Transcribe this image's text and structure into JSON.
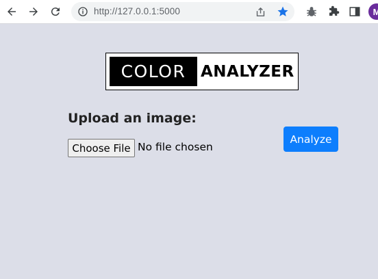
{
  "browser": {
    "url": "http://127.0.0.1:5000",
    "profile_initial": "M",
    "icons": {
      "back": "back-arrow-icon",
      "forward": "forward-arrow-icon",
      "reload": "reload-icon",
      "info": "info-icon",
      "share": "share-icon",
      "bookmark": "star-icon",
      "extension_bug": "bug-icon",
      "extensions": "puzzle-icon",
      "side_panel": "side-panel-icon"
    },
    "colors": {
      "star": "#1a73e8",
      "avatar": "#6a2d9c"
    }
  },
  "page": {
    "logo": {
      "part1": "COLOR",
      "part2": "ANALYZER"
    },
    "upload_label": "Upload an image:",
    "file_button": "Choose File",
    "file_status": "No file chosen",
    "analyze_button": "Analyze",
    "colors": {
      "background": "#dcdee8",
      "button": "#0d7efd"
    }
  }
}
